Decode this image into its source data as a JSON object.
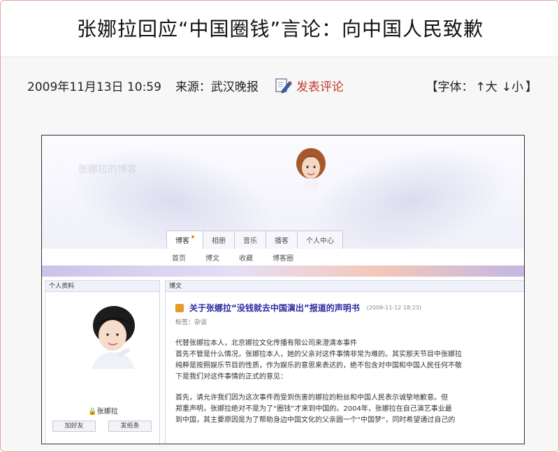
{
  "article": {
    "headline": "张娜拉回应“中国圈钱”言论：向中国人民致歉",
    "date": "2009年11月13日 10:59",
    "source": "来源：武汉晚报",
    "comment_label": "发表评论",
    "font_label": "【字体：",
    "font_up": "↑大",
    "font_down": "↓小",
    "font_close": "】"
  },
  "blog": {
    "name": "张娜拉的博客",
    "tabs": [
      "博客",
      "相册",
      "音乐",
      "播客",
      "个人中心"
    ],
    "subnav": [
      "首页",
      "博文",
      "收藏",
      "博客圈"
    ],
    "profile": {
      "header": "个人资料",
      "username": "张娜拉",
      "buttons": [
        "加好友",
        "发纸条"
      ]
    },
    "posts_header": "博文",
    "post": {
      "title": "关于张娜拉“没钱就去中国演出”报道的声明书",
      "date": "(2009-11-12 18:23)",
      "tag": "标签：杂谈",
      "lines": [
        "代替张娜拉本人，北京娜拉文化传播有限公司来澄清本事件",
        "首先不管是什么情况，张娜拉本人，她的父亲对这件事情非常为难的。其实那天节目中张娜拉",
        "纯粹是按照娱乐节目的性质，作为娱乐的意思来表达的，绝不包含对中国和中国人民任何不敬",
        "下是我们对这件事情的正式的意见：",
        "",
        "    首先，请允许我们因为这次事件而受到伤害的娜拉的粉丝和中国人民表示诚挚地歉意。但",
        "郑重声明，张娜拉绝对不是为了“圈钱”才来到中国的。2004年，张娜拉在自己演艺事业最",
        "到中国，其主要原因是为了帮助身边中国文化的父亲圆一个“中国梦”，同时希望通过自己的"
      ]
    }
  },
  "colors": {
    "comment": "#c0392b",
    "frame_border": "#e0a8a0",
    "post_title": "#2a2aa0"
  }
}
